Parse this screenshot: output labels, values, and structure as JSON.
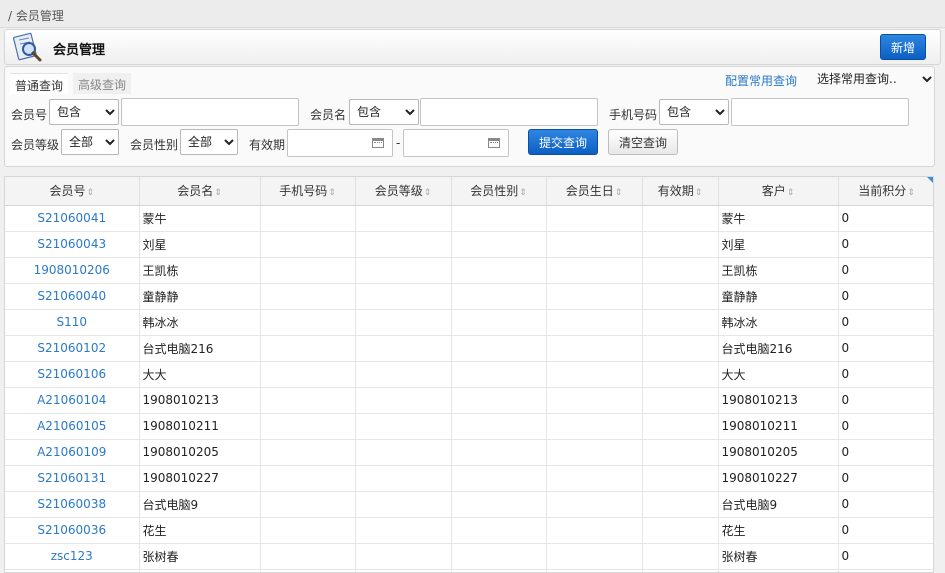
{
  "breadcrumb": "/ 会员管理",
  "header": {
    "title": "会员管理",
    "new_label": "新增"
  },
  "tabs": [
    "普通查询",
    "高级查询"
  ],
  "config_link": "配置常用查询",
  "common_query": "选择常用查询..",
  "filters": {
    "code_label": "会员号",
    "code_op": "包含",
    "code_value": "",
    "name_label": "会员名",
    "name_op": "包含",
    "name_value": "",
    "phone_label": "手机号码",
    "phone_op": "包含",
    "phone_value": "",
    "level_label": "会员等级",
    "level_value": "全部",
    "gender_label": "会员性别",
    "gender_value": "全部",
    "valid_label": "有效期",
    "valid_from": "",
    "valid_to": "",
    "dash": "-"
  },
  "buttons": {
    "submit": "提交查询",
    "clear": "清空查询"
  },
  "table": {
    "sort_glyph": "⇕",
    "columns": [
      "会员号",
      "会员名",
      "手机号码",
      "会员等级",
      "会员性别",
      "会员生日",
      "有效期",
      "客户",
      "当前积分"
    ],
    "rows": [
      [
        "S21060041",
        "蒙牛",
        "",
        "",
        "",
        "",
        "",
        "蒙牛",
        "0"
      ],
      [
        "S21060043",
        "刘星",
        "",
        "",
        "",
        "",
        "",
        "刘星",
        "0"
      ],
      [
        "1908010206",
        "王凯栋",
        "",
        "",
        "",
        "",
        "",
        "王凯栋",
        "0"
      ],
      [
        "S21060040",
        "童静静",
        "",
        "",
        "",
        "",
        "",
        "童静静",
        "0"
      ],
      [
        "S110",
        "韩冰冰",
        "",
        "",
        "",
        "",
        "",
        "韩冰冰",
        "0"
      ],
      [
        "S21060102",
        "台式电脑216",
        "",
        "",
        "",
        "",
        "",
        "台式电脑216",
        "0"
      ],
      [
        "S21060106",
        "大大",
        "",
        "",
        "",
        "",
        "",
        "大大",
        "0"
      ],
      [
        "A21060104",
        "1908010213",
        "",
        "",
        "",
        "",
        "",
        "1908010213",
        "0"
      ],
      [
        "A21060105",
        "1908010211",
        "",
        "",
        "",
        "",
        "",
        "1908010211",
        "0"
      ],
      [
        "A21060109",
        "1908010205",
        "",
        "",
        "",
        "",
        "",
        "1908010205",
        "0"
      ],
      [
        "S21060131",
        "1908010227",
        "",
        "",
        "",
        "",
        "",
        "1908010227",
        "0"
      ],
      [
        "S21060038",
        "台式电脑9",
        "",
        "",
        "",
        "",
        "",
        "台式电脑9",
        "0"
      ],
      [
        "S21060036",
        "花生",
        "",
        "",
        "",
        "",
        "",
        "花生",
        "0"
      ],
      [
        "zsc123",
        "张树春",
        "",
        "",
        "",
        "",
        "",
        "张树春",
        "0"
      ],
      [
        "",
        "",
        "",
        "",
        "",
        "",
        "",
        "",
        ""
      ]
    ]
  }
}
